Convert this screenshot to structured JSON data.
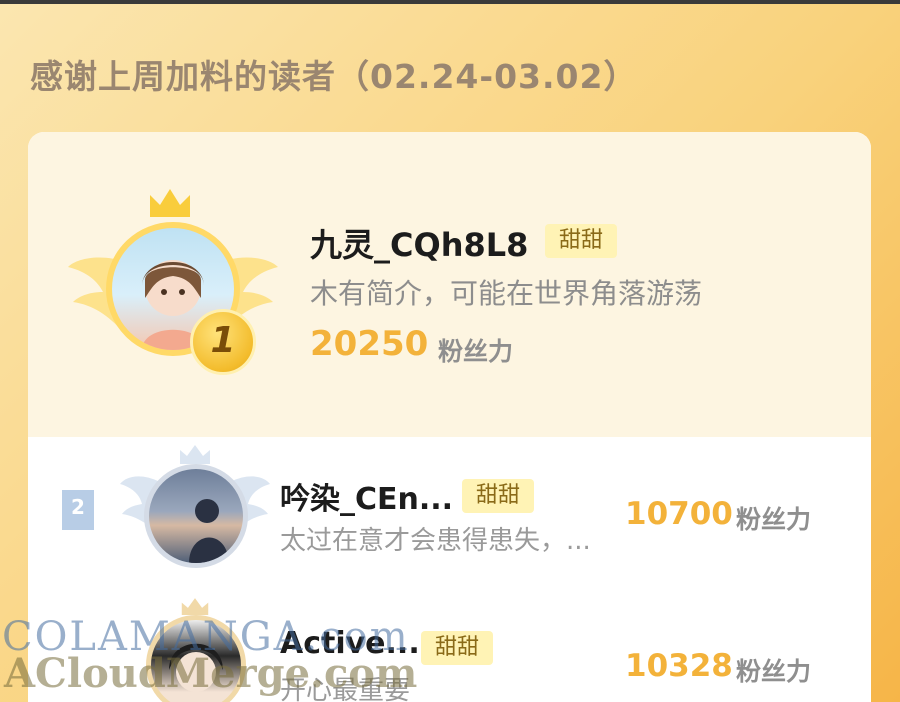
{
  "heading": "感谢上周加料的读者（02.24-03.02）",
  "rank1": {
    "rank": "1",
    "name": "九灵_CQh8L8",
    "tag": "甜甜",
    "bio": "木有简介，可能在世界角落游荡",
    "score": "20250",
    "unit": "粉丝力"
  },
  "rank2": {
    "rank": "2",
    "name": "吟染_CEn...",
    "tag": "甜甜",
    "bio": "太过在意才会患得患失，...",
    "score": "10700",
    "unit": "粉丝力"
  },
  "rank3": {
    "name": "Active...",
    "tag": "甜甜",
    "bio": "开心最重要",
    "score": "10328",
    "unit": "粉丝力"
  },
  "watermark": {
    "line1": "COLAMANGA.com",
    "line2": "ACloudMerge.com"
  },
  "colors": {
    "score": "#f3b23a",
    "tag_bg": "#fff3b5",
    "gold": "#f3bc2c"
  }
}
